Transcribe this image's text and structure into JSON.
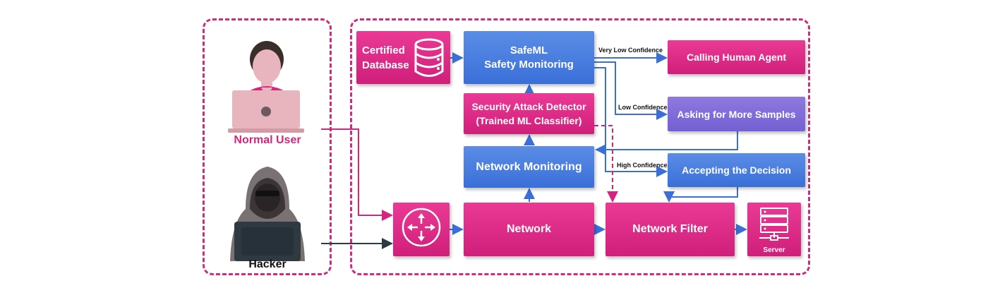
{
  "actors": {
    "normal_user": "Normal User",
    "hacker": "Hacker"
  },
  "nodes": {
    "certified_database": "Certified Database",
    "safeml": "SafeML\nSafety Monitoring",
    "security_detector": "Security Attack Detector\n(Trained ML Classifier)",
    "network_monitoring": "Network Monitoring",
    "network": "Network",
    "network_filter": "Network Filter",
    "server": "Server",
    "calling_human_agent": "Calling Human Agent",
    "asking_more_samples": "Asking for More Samples",
    "accepting_decision": "Accepting the Decision"
  },
  "edge_labels": {
    "very_low": "Very Low Confidence",
    "low": "Low Confidence",
    "high": "High Confidence"
  },
  "colors": {
    "pink": "#d7257f",
    "blue": "#4a7ddd",
    "purple": "#7e6ad8",
    "dash": "#cc2e7d",
    "arrow": "#3a6fd8"
  },
  "icons": [
    "user-icon",
    "laptop-icon",
    "hacker-icon",
    "database-icon",
    "router-icon",
    "server-icon"
  ]
}
